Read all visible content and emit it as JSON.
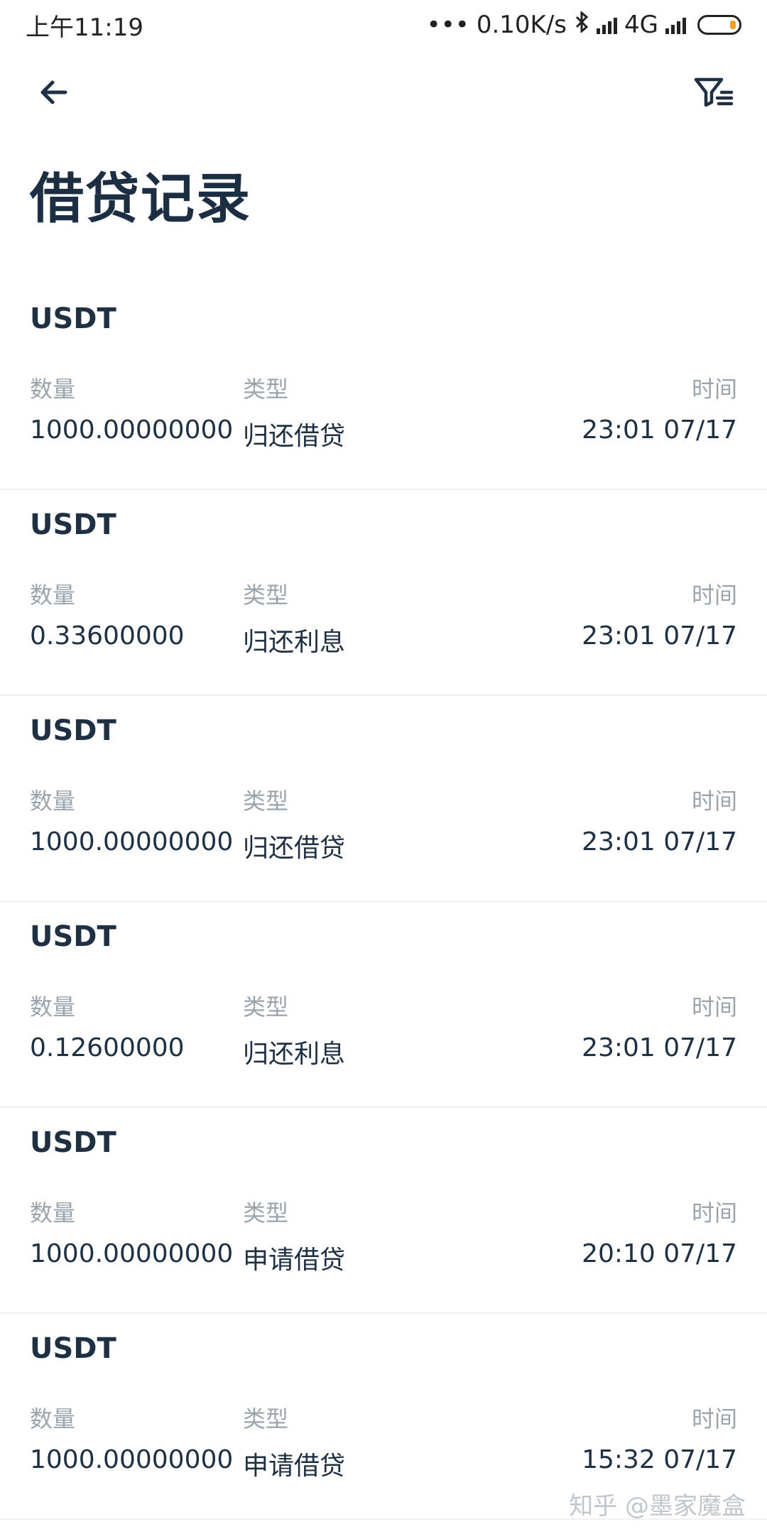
{
  "status_bar": {
    "time": "上午11:19",
    "dots": "•••",
    "net_speed": "0.10K/s",
    "bluetooth": "bluetooth-icon",
    "network": "4G",
    "battery": "battery-icon"
  },
  "header": {
    "back_icon": "arrow-left-icon",
    "filter_icon": "filter-icon",
    "title": "借贷记录"
  },
  "labels": {
    "amount": "数量",
    "type": "类型",
    "time": "时间"
  },
  "records": [
    {
      "coin": "USDT",
      "amount": "1000.00000000",
      "type": "归还借贷",
      "time": "23:01 07/17"
    },
    {
      "coin": "USDT",
      "amount": "0.33600000",
      "type": "归还利息",
      "time": "23:01 07/17"
    },
    {
      "coin": "USDT",
      "amount": "1000.00000000",
      "type": "归还借贷",
      "time": "23:01 07/17"
    },
    {
      "coin": "USDT",
      "amount": "0.12600000",
      "type": "归还利息",
      "time": "23:01 07/17"
    },
    {
      "coin": "USDT",
      "amount": "1000.00000000",
      "type": "申请借贷",
      "time": "20:10 07/17"
    },
    {
      "coin": "USDT",
      "amount": "1000.00000000",
      "type": "申请借贷",
      "time": "15:32 07/17"
    }
  ],
  "watermark": "知乎 @墨家魔盒",
  "colors": {
    "text_dark": "#1f3043",
    "label_gray": "#9aa4ad",
    "divider": "#eef1f4",
    "battery_accent": "#f0a020"
  }
}
